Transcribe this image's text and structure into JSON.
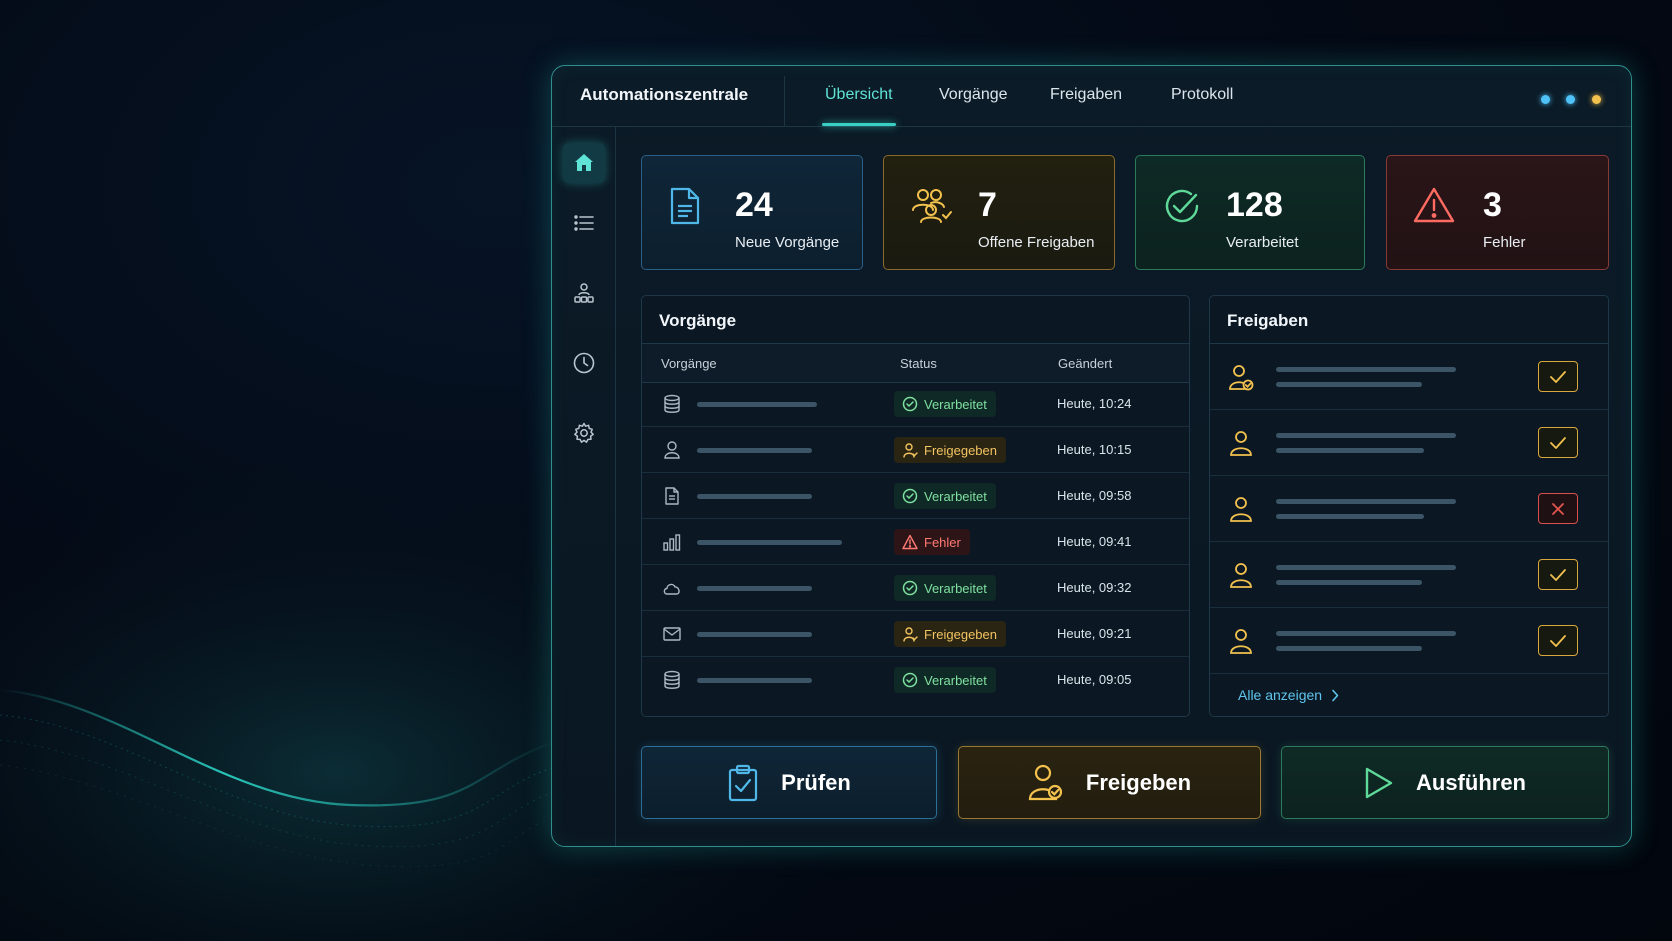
{
  "app": {
    "title": "Automationszentrale"
  },
  "tabs": [
    {
      "label": "Übersicht",
      "active": true
    },
    {
      "label": "Vorgänge",
      "active": false
    },
    {
      "label": "Freigaben",
      "active": false
    },
    {
      "label": "Protokoll",
      "active": false
    }
  ],
  "window_dots": [
    "#4fc3f7",
    "#4fc3f7",
    "#f2c14e"
  ],
  "sidebar": {
    "items": [
      {
        "icon": "home-icon",
        "active": true
      },
      {
        "icon": "list-icon",
        "active": false
      },
      {
        "icon": "org-chart-icon",
        "active": false
      },
      {
        "icon": "clock-icon",
        "active": false
      },
      {
        "icon": "gear-icon",
        "active": false
      }
    ]
  },
  "kpis": [
    {
      "value": "24",
      "label": "Neue Vorgänge",
      "icon": "document-icon",
      "color": "#4fb8e8"
    },
    {
      "value": "7",
      "label": "Offene Freigaben",
      "icon": "users-check-icon",
      "color": "#f2c14e"
    },
    {
      "value": "128",
      "label": "Verarbeitet",
      "icon": "check-circle-icon",
      "color": "#5fd99a"
    },
    {
      "value": "3",
      "label": "Fehler",
      "icon": "warning-icon",
      "color": "#ff6b61"
    }
  ],
  "processes": {
    "title": "Vorgänge",
    "columns": {
      "name": "Vorgänge",
      "status": "Status",
      "changed": "Geändert"
    },
    "rows": [
      {
        "icon": "database-icon",
        "status": "Verarbeitet",
        "kind": "ok",
        "changed": "Heute, 10:24"
      },
      {
        "icon": "user-icon",
        "status": "Freigegeben",
        "kind": "approved",
        "changed": "Heute, 10:15"
      },
      {
        "icon": "document-icon",
        "status": "Verarbeitet",
        "kind": "ok",
        "changed": "Heute, 09:58"
      },
      {
        "icon": "bar-chart-icon",
        "status": "Fehler",
        "kind": "error",
        "changed": "Heute, 09:41"
      },
      {
        "icon": "cloud-icon",
        "status": "Verarbeitet",
        "kind": "ok",
        "changed": "Heute, 09:32"
      },
      {
        "icon": "mail-icon",
        "status": "Freigegeben",
        "kind": "approved",
        "changed": "Heute, 09:21"
      },
      {
        "icon": "database-icon",
        "status": "Verarbeitet",
        "kind": "ok",
        "changed": "Heute, 09:05"
      }
    ]
  },
  "approvals": {
    "title": "Freigaben",
    "items": [
      {
        "icon": "user-check-icon",
        "decision": "approved"
      },
      {
        "icon": "user-icon",
        "decision": "approved"
      },
      {
        "icon": "user-icon",
        "decision": "rejected"
      },
      {
        "icon": "user-icon",
        "decision": "approved"
      },
      {
        "icon": "user-icon",
        "decision": "approved"
      }
    ],
    "show_all": "Alle anzeigen"
  },
  "actions": [
    {
      "label": "Prüfen",
      "icon": "clipboard-check-icon",
      "color": "#4fb8e8"
    },
    {
      "label": "Freigeben",
      "icon": "user-check-icon",
      "color": "#f2c14e"
    },
    {
      "label": "Ausführen",
      "icon": "play-icon",
      "color": "#5fd99a"
    }
  ]
}
